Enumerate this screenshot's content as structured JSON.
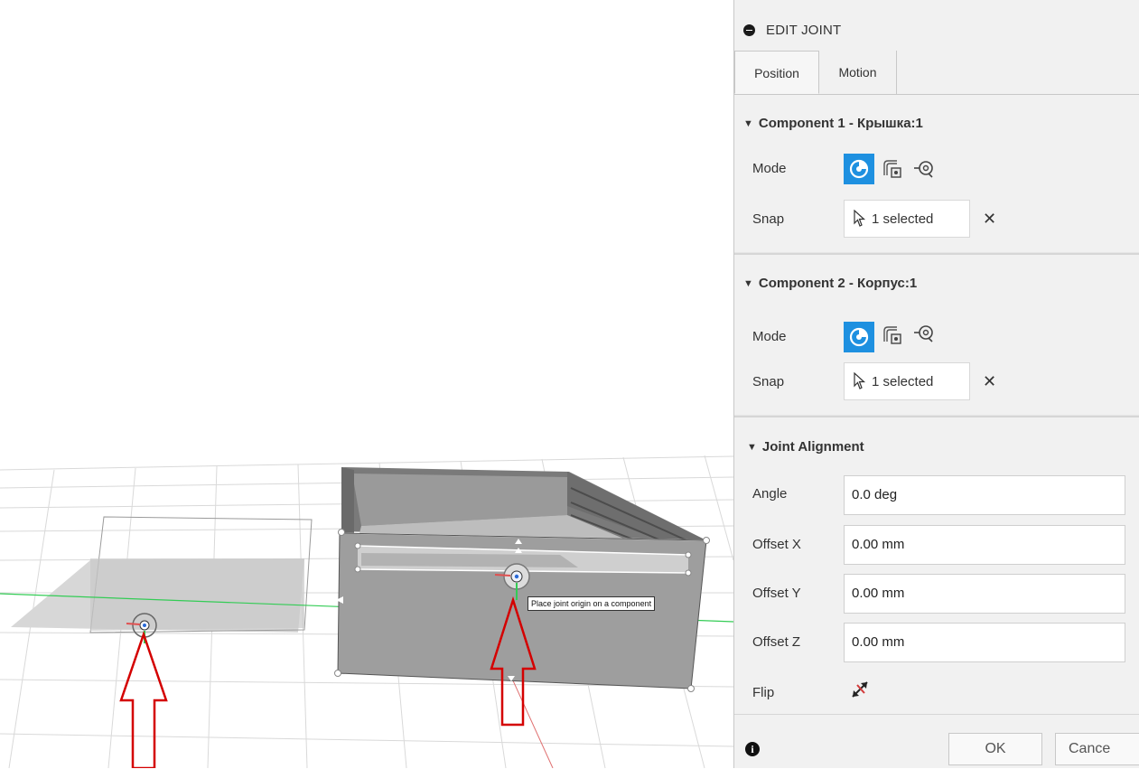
{
  "viewport": {
    "tooltip": "Place joint origin on a component"
  },
  "panel": {
    "title": "EDIT JOINT",
    "tabs": [
      {
        "label": "Position",
        "active": true
      },
      {
        "label": "Motion",
        "active": false
      }
    ],
    "component1": {
      "title": "Component 1 - Крышка:1",
      "mode_label": "Mode",
      "mode_selected": "simple",
      "snap_label": "Snap",
      "snap_value": "1 selected"
    },
    "component2": {
      "title": "Component 2 - Корпус:1",
      "mode_label": "Mode",
      "mode_selected": "simple",
      "snap_label": "Snap",
      "snap_value": "1 selected"
    },
    "alignment": {
      "title": "Joint Alignment",
      "angle_label": "Angle",
      "angle_value": "0.0 deg",
      "offset_x_label": "Offset X",
      "offset_x_value": "0.00 mm",
      "offset_y_label": "Offset Y",
      "offset_y_value": "0.00 mm",
      "offset_z_label": "Offset Z",
      "offset_z_value": "0.00 mm",
      "flip_label": "Flip"
    },
    "footer": {
      "ok_label": "OK",
      "cancel_label": "Cance"
    }
  },
  "colors": {
    "accent": "#1e90e0",
    "arrow": "#d40000",
    "axis_green": "#33cc55",
    "axis_red": "#e05050"
  }
}
